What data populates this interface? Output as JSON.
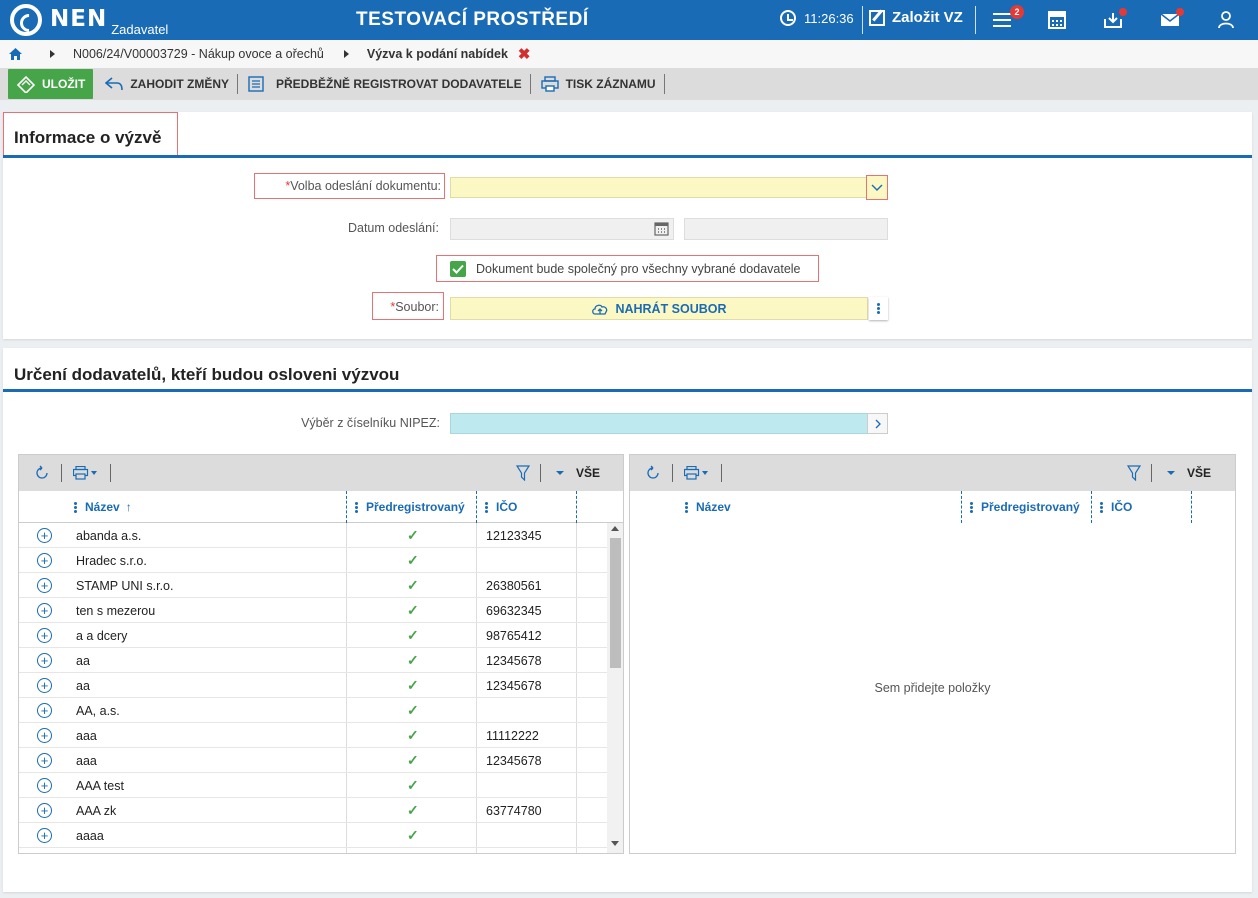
{
  "header": {
    "logo_text": "NEN",
    "logo_sub": "Zadavatel",
    "env_title": "TESTOVACÍ PROSTŘEDÍ",
    "clock": "11:26:36",
    "create_label": "Založit VZ",
    "notification_count": "2",
    "icons": [
      "menu-icon",
      "calculator-icon",
      "inbox-icon",
      "mail-icon",
      "user-icon"
    ]
  },
  "breadcrumb": {
    "items": [
      "N006/24/V00003729 - Nákup ovoce a ořechů",
      "Výzva k podání nabídek"
    ],
    "close": "✖"
  },
  "toolbar": {
    "save": "ULOŽIT",
    "discard": "ZAHODIT ZMĚNY",
    "preregister": "PŘEDBĚŽNĚ REGISTROVAT DODAVATELE",
    "print": "TISK ZÁZNAMU"
  },
  "info_section": {
    "title": "Informace o výzvě",
    "send_option_label": "Volba odeslání dokumentu:",
    "send_option_value": "",
    "date_label": "Datum odeslání:",
    "common_doc_label": "Dokument bude společný pro všechny vybrané dodavatele",
    "common_doc_checked": true,
    "file_label": "Soubor:",
    "upload_button": "NAHRÁT SOUBOR"
  },
  "suppliers_section": {
    "title": "Určení dodavatelů, kteří budou osloveni výzvou",
    "nipez_label": "Výběr z číselníku NIPEZ:",
    "left_grid": {
      "toolbar_all": "VŠE",
      "columns": [
        "Název",
        "Předregistrovaný",
        "IČO"
      ],
      "rows": [
        {
          "name": "abanda a.s.",
          "prereg": true,
          "ico": "12123345"
        },
        {
          "name": "Hradec s.r.o.",
          "prereg": true,
          "ico": ""
        },
        {
          "name": "STAMP UNI s.r.o.",
          "prereg": true,
          "ico": "26380561"
        },
        {
          "name": "ten s mezerou",
          "prereg": true,
          "ico": "69632345"
        },
        {
          "name": "a a dcery",
          "prereg": true,
          "ico": "98765412"
        },
        {
          "name": "aa",
          "prereg": true,
          "ico": "12345678"
        },
        {
          "name": "aa",
          "prereg": true,
          "ico": "12345678"
        },
        {
          "name": "AA, a.s.",
          "prereg": true,
          "ico": ""
        },
        {
          "name": "aaa",
          "prereg": true,
          "ico": "11112222"
        },
        {
          "name": "aaa",
          "prereg": true,
          "ico": "12345678"
        },
        {
          "name": "AAA test",
          "prereg": true,
          "ico": ""
        },
        {
          "name": "AAA zk",
          "prereg": true,
          "ico": "63774780"
        },
        {
          "name": "aaaa",
          "prereg": true,
          "ico": ""
        }
      ]
    },
    "right_grid": {
      "toolbar_all": "VŠE",
      "columns": [
        "Název",
        "Předregistrovaný",
        "IČO"
      ],
      "empty_text": "Sem přidejte položky"
    }
  }
}
